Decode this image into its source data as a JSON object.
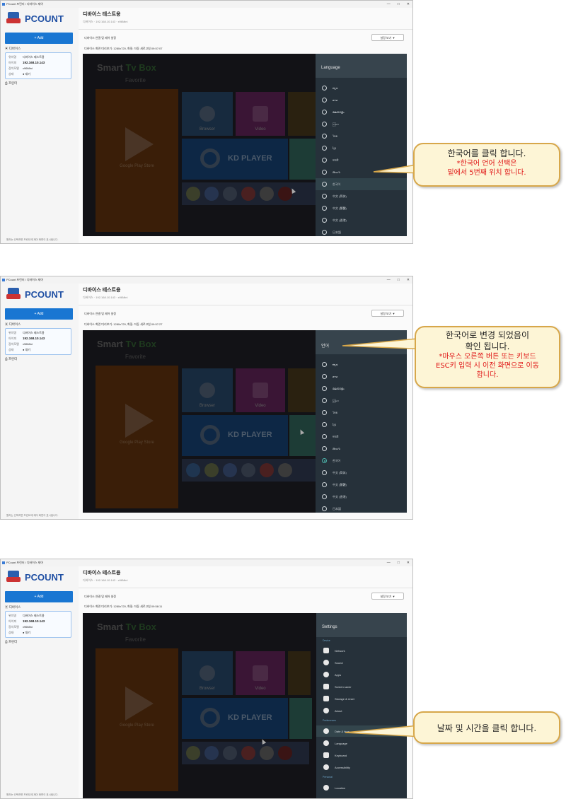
{
  "app": {
    "window_title": "PCount 프린터 / 디바이스 제어",
    "logo_text": "PCOUNT",
    "add_label": "+ Add",
    "devices_label": "디바이스",
    "remote_label": "프린터",
    "device": {
      "name_key": "위치명",
      "name_val": "디바이스 테스트용",
      "ip_key": "아이피",
      "ip_val": "192.168.10.143",
      "model_key": "장치모델",
      "model_val": "x96Mini",
      "status_key": "상태",
      "status_val": "● 대기"
    },
    "sidebar_footer": "원하는 선택하면 프린트에 제어 화면이 표시됩니다.",
    "main_title": "디바이스 테스트용",
    "main_subtitle": "디바이스 · 192.168.10.143 · x96Mini",
    "control_label": "디바이스 연결 및 제어 설정",
    "view_button": "설정 보기 ▼",
    "screen_info_1": "디바이스 화면 미리보기: 1280x720, 화질: 자동 새로고침 09:57:07",
    "screen_info_2": "디바이스 화면 미리보기: 1280x720, 화질: 자동 새로고침 09:57:27",
    "screen_info_3": "디바이스 화면 미리보기: 1280x720, 화질: 자동 새로고침 09:58:11"
  },
  "tv": {
    "title_a": "Smart",
    "title_b": "Tv Box",
    "favorite": "Favorite",
    "google_play": "Google Play Store",
    "browser": "Browser",
    "video": "Video",
    "kd_player": "KD PLAYER",
    "music": "Music"
  },
  "language_dialog_1": {
    "title": "Language",
    "items": [
      "ಕನ್ನಡ",
      "ລາວ",
      "മലയാളം",
      "မြန်မာ",
      "ไทย",
      "ខ្មែរ",
      "मराठी",
      "తెలుగు",
      "한국어",
      "中文 (简体)",
      "中文 (繁體)",
      "中文 (香港)",
      "日本語"
    ],
    "highlighted_index": 8,
    "selected_index": -1
  },
  "language_dialog_2": {
    "title": "언어",
    "items": [
      "ಕನ್ನಡ",
      "ລາວ",
      "മലയാളം",
      "မြန်မာ",
      "ไทย",
      "ខ្មែរ",
      "मराठी",
      "తెలుగు",
      "한국어",
      "中文 (简体)",
      "中文 (繁體)",
      "中文 (香港)",
      "日本語"
    ],
    "highlighted_index": -1,
    "selected_index": 8
  },
  "settings_dialog": {
    "title": "Settings",
    "device_section": "Device",
    "device_items": [
      "Network",
      "Sound",
      "Apps",
      "Screen saver",
      "Storage & reset",
      "About"
    ],
    "preferences_section": "Preferences",
    "pref_items": [
      "Date & time",
      "Language",
      "Keyboard",
      "Accessibility"
    ],
    "personal_section": "Personal",
    "personal_items": [
      "Location"
    ]
  },
  "callouts": {
    "c1_main": "한국어를 클릭 합니다.",
    "c1_note_1": "*한국어 언어 선택은",
    "c1_note_2": "밑에서 5번째 위치 합니다.",
    "c2_main_1": "한국어로 변경 되었음이",
    "c2_main_2": "확인 됩니다.",
    "c2_note_1": "*마우스 오른쪽 버튼 또는 키보드",
    "c2_note_2": "ESC키 입력 시 이전 화면으로 이동",
    "c2_note_3": "합니다.",
    "c3_main": "날짜 및 시간을 클릭 합니다."
  },
  "colors": {
    "accent": "#1976d2",
    "callout_bg": "#fdf5d6",
    "callout_border": "#d7a74a",
    "note_red": "#e01818",
    "dialog_bg": "#26313a"
  }
}
